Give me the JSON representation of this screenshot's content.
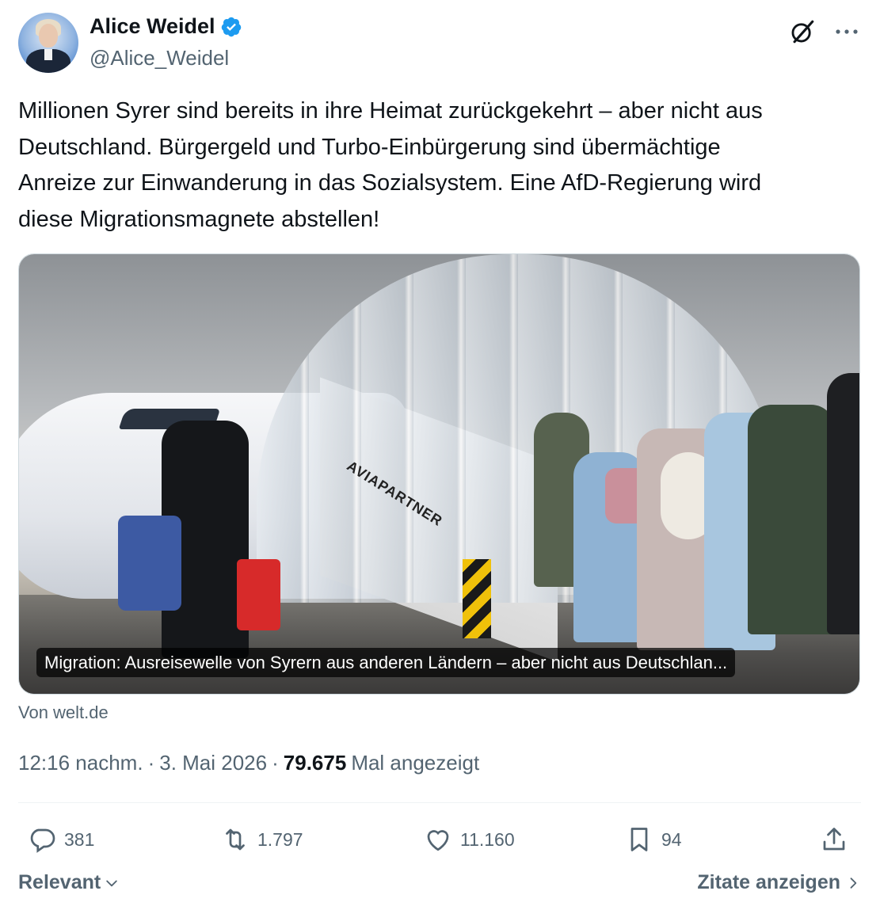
{
  "author": {
    "display_name": "Alice Weidel",
    "handle": "@Alice_Weidel"
  },
  "icons": {
    "verified": "verified-badge-icon",
    "grok": "grok-icon",
    "more": "more-icon"
  },
  "tweet": {
    "text": "Millionen Syrer sind bereits in ihre Heimat zurückgekehrt – aber nicht aus\nDeutschland. Bürgergeld und Turbo-Einbürgerung sind übermächtige\nAnreize zur Einwanderung in das Sozialsystem. Eine AfD-Regierung wird\ndiese Migrationsmagnete abstellen!"
  },
  "card": {
    "image_text": "AVIAPARTNER",
    "caption": "Migration: Ausreisewelle von Syrern aus anderen Ländern – aber nicht aus Deutschlan...",
    "source": "Von welt.de"
  },
  "meta": {
    "time": "12:16 nachm.",
    "separator": "·",
    "date": "3. Mai 2026",
    "views_count": "79.675",
    "views_label": "Mal angezeigt"
  },
  "actions": {
    "replies": "381",
    "retweets": "1.797",
    "likes": "11.160",
    "bookmarks": "94"
  },
  "footer": {
    "sort_label": "Relevant",
    "quotes_label": "Zitate anzeigen"
  },
  "colors": {
    "text": "#0f1419",
    "secondary": "#536471",
    "verified": "#1d9bf0",
    "border": "#cfd9de"
  }
}
